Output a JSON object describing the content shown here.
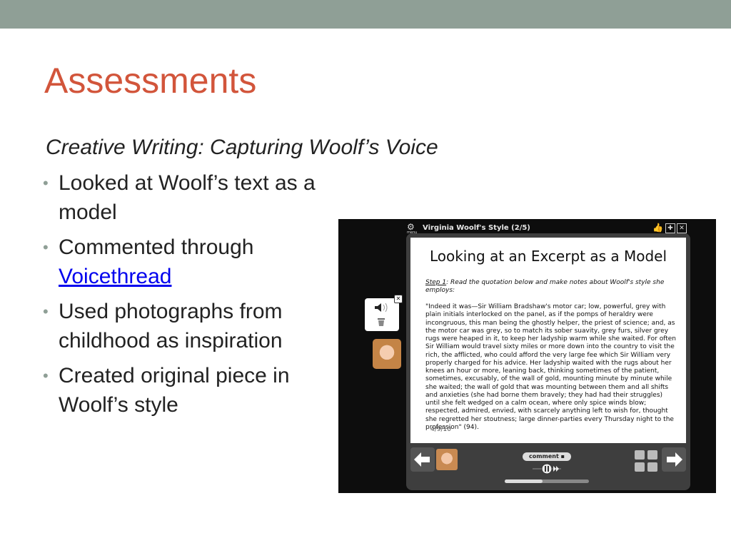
{
  "slide": {
    "title": "Assessments",
    "subtitle": "Creative Writing: Capturing Woolf’s Voice",
    "bullets": [
      {
        "text": "Looked at Woolf’s text as a model"
      },
      {
        "text_before": "Commented through",
        "link": "Voicethread"
      },
      {
        "text": "Used photographs from childhood as inspiration"
      },
      {
        "text": "Created original piece in Woolf’s style"
      }
    ],
    "colors": {
      "topbar": "#8f9f96",
      "title": "#d2553b",
      "link": "#0000ee"
    }
  },
  "voicethread": {
    "menu_label": "menu",
    "header_title": "Virginia Woolf's Style (2/5)",
    "page_title": "Looking at an Excerpt as a Model",
    "step_label": "Step 1",
    "step_text": ": Read the quotation below and make notes about Woolf's style she employs:",
    "quote": "\"Indeed it was—Sir William Bradshaw's motor car; low, powerful, grey with plain initials interlocked on the panel, as if the pomps of heraldry were incongruous, this man being the ghostly helper, the priest of science; and, as the motor car was grey, so to match its sober suavity, grey furs, silver grey rugs were heaped in it, to keep her ladyship warm while she waited. For often Sir William would travel sixty miles or more down into the country to visit the rich, the afflicted, who could afford the very large fee which Sir William very properly charged for his advice. Her ladyship waited with the rugs about her knees an hour or more, leaning back, thinking sometimes of the patient, sometimes, excusably, of the wall of gold, mounting minute by minute while she waited; the wall of gold that was mounting between them and all shifts and anxieties (she had borne them bravely; they had had their struggles) until she felt wedged on a calm ocean, where only spice winds blow; respected, admired, envied, with scarcely anything left to wish for, thought she regretted her stoutness; large dinner-parties every Thursday night to the profession\" (94).",
    "date": "4/9/10",
    "comment_label": "comment",
    "progress": 0.45,
    "icons": {
      "menu": "gear-icon",
      "thumbs": "thumbs-up-icon",
      "expand": "expand-icon",
      "close": "close-icon",
      "prev": "arrow-left-icon",
      "next": "arrow-right-icon",
      "speaker": "speaker-icon",
      "trash": "trash-icon"
    }
  }
}
